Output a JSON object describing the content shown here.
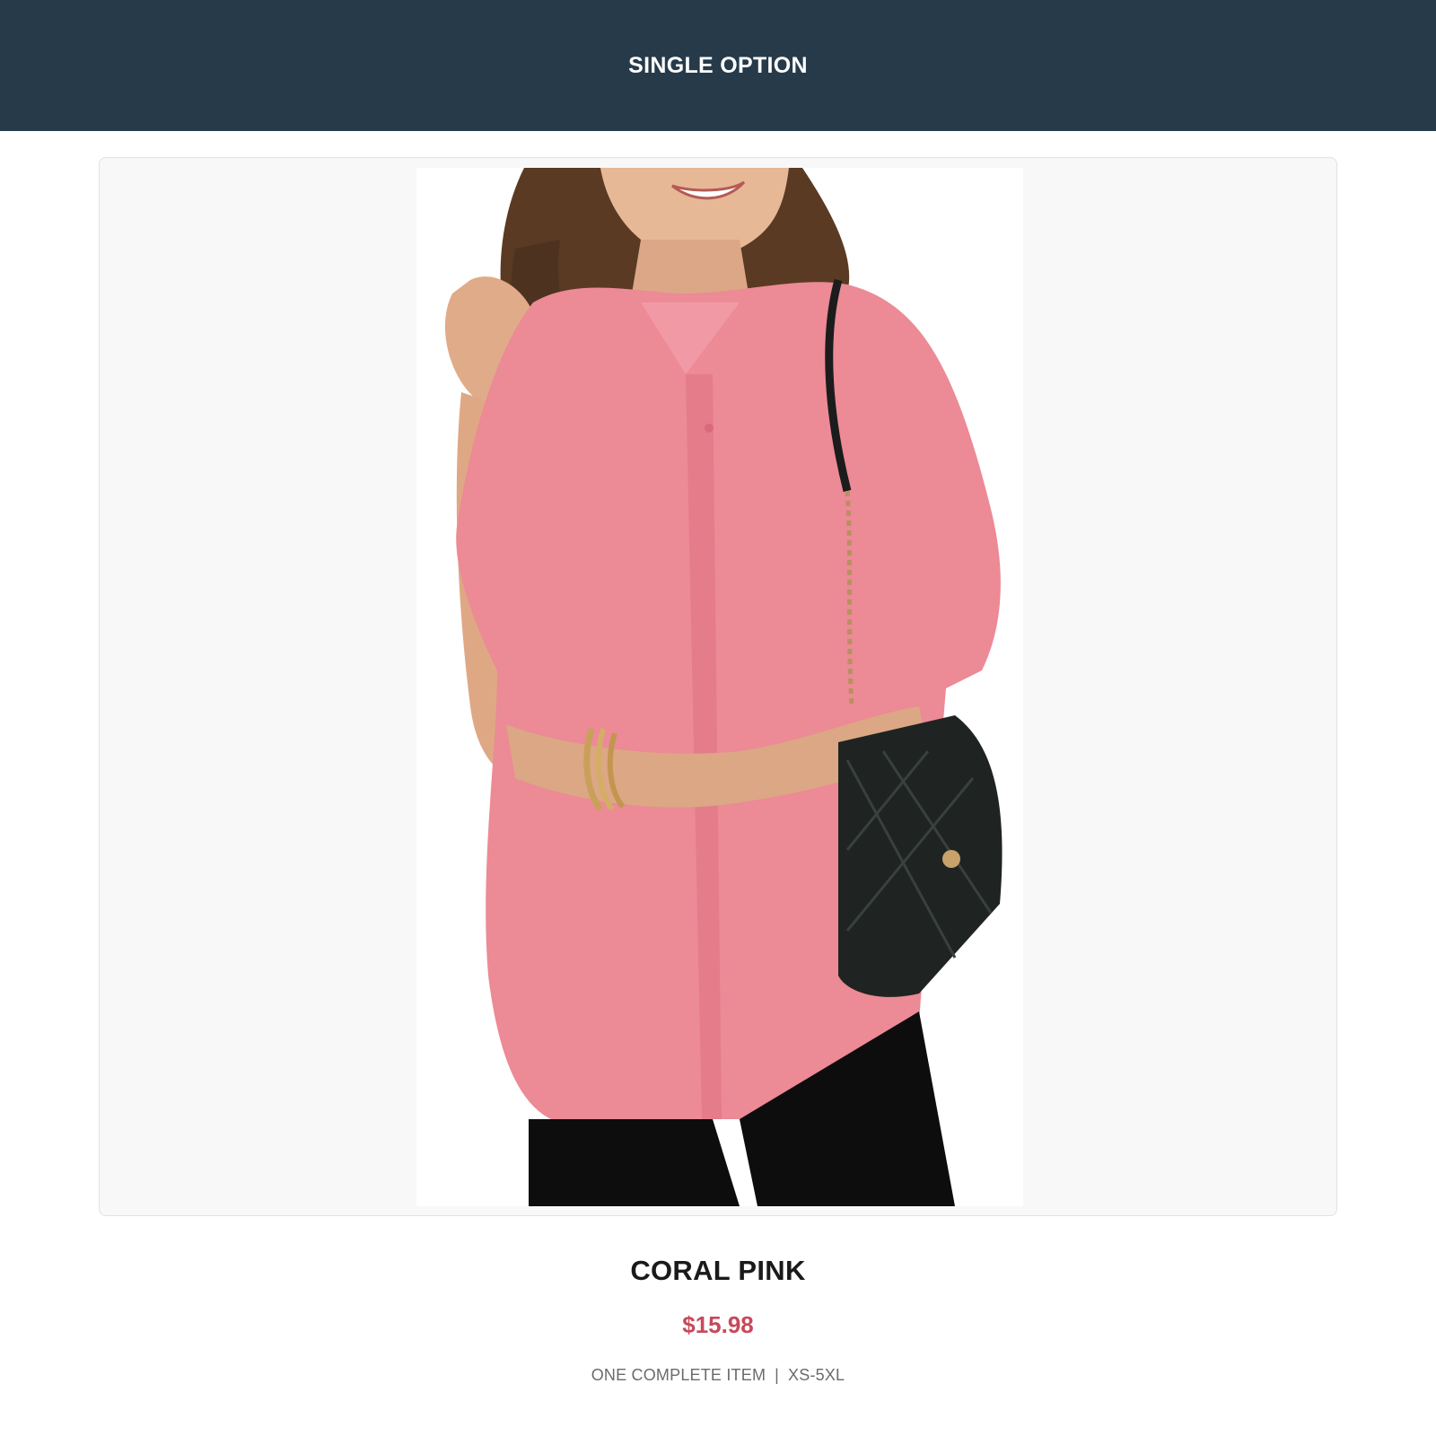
{
  "colors": {
    "header_bg": "#263a4a",
    "card_bg": "#f8f8f8",
    "price": "#c9485b",
    "shirt": "#ec8a96"
  },
  "header": {
    "title": "SINGLE OPTION"
  },
  "product": {
    "image_icon": "product-photo",
    "name": "CORAL PINK",
    "price": "$15.98",
    "meta": {
      "part1": "ONE COMPLETE ITEM",
      "separator": "|",
      "part2": "XS-5XL"
    }
  }
}
